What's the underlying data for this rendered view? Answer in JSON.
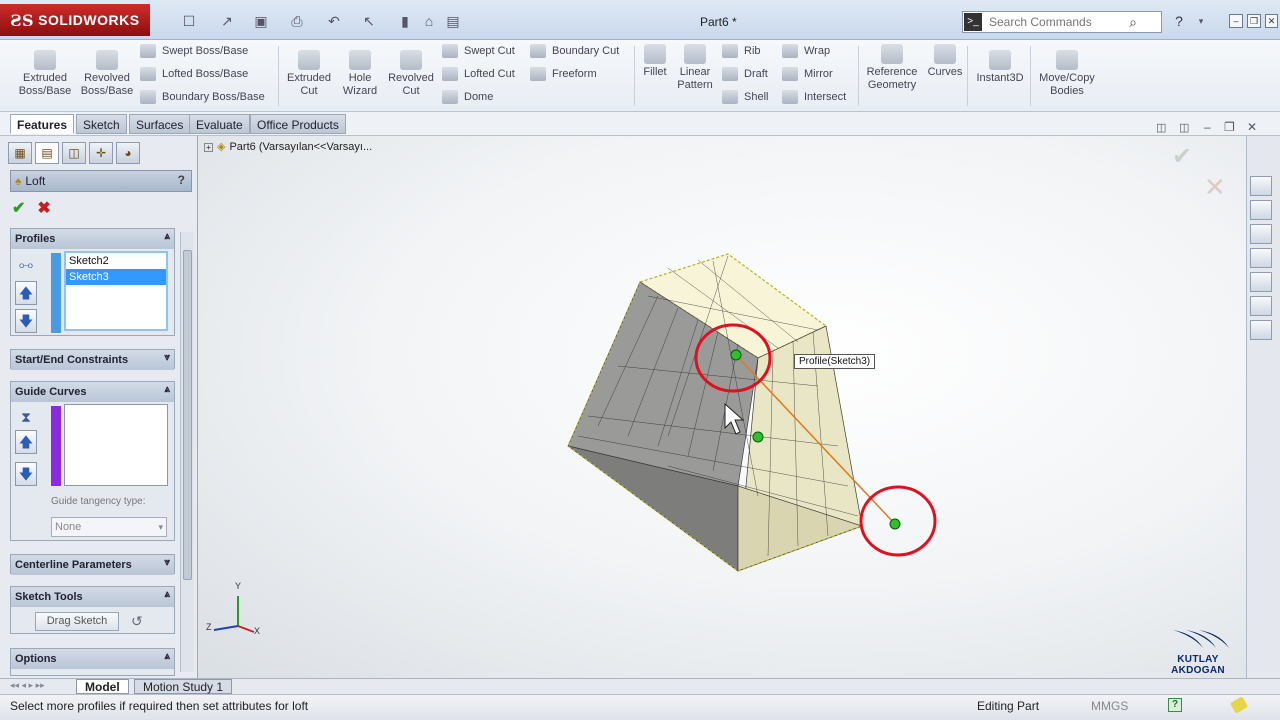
{
  "app": {
    "logo_text": "SOLIDWORKS",
    "document_title": "Part6 *",
    "search_placeholder": "Search Commands"
  },
  "ribbon": {
    "extruded_boss": "Extruded\nBoss/Base",
    "revolved_boss": "Revolved\nBoss/Base",
    "swept_boss": "Swept Boss/Base",
    "lofted_boss": "Lofted Boss/Base",
    "boundary_boss": "Boundary Boss/Base",
    "extruded_cut": "Extruded\nCut",
    "hole_wizard": "Hole\nWizard",
    "revolved_cut": "Revolved\nCut",
    "swept_cut": "Swept Cut",
    "lofted_cut": "Lofted Cut",
    "boundary_cut": "Boundary Cut",
    "dome": "Dome",
    "freeform": "Freeform",
    "fillet": "Fillet",
    "linear_pattern": "Linear\nPattern",
    "rib": "Rib",
    "draft": "Draft",
    "shell": "Shell",
    "wrap": "Wrap",
    "mirror": "Mirror",
    "intersect": "Intersect",
    "reference_geometry": "Reference\nGeometry",
    "curves": "Curves",
    "instant3d": "Instant3D",
    "move_copy_bodies": "Move/Copy\nBodies"
  },
  "command_tabs": [
    "Features",
    "Sketch",
    "Surfaces",
    "Evaluate",
    "Office Products"
  ],
  "property_manager": {
    "title": "Loft",
    "help": "?",
    "profiles": {
      "label": "Profiles",
      "items": [
        "Sketch2",
        "Sketch3"
      ],
      "selected": "Sketch3"
    },
    "start_end_constraints": "Start/End Constraints",
    "guide_curves": {
      "label": "Guide Curves",
      "tangency_label": "Guide tangency type:",
      "tangency_value": "None"
    },
    "centerline_parameters": "Centerline Parameters",
    "sketch_tools": {
      "label": "Sketch Tools",
      "drag_sketch": "Drag Sketch"
    },
    "options": "Options"
  },
  "viewport": {
    "tree_node": "Part6  (Varsayılan<<Varsayı...",
    "tooltip": "Profile(Sketch3)",
    "triad": {
      "x": "X",
      "y": "Y",
      "z": "Z"
    },
    "brand_name": "KUTLAY AKDOGAN"
  },
  "bottom_tabs": [
    "Model",
    "Motion Study 1"
  ],
  "status": {
    "message": "Select more profiles if required then set attributes for loft",
    "mode": "Editing Part",
    "units": "MMGS"
  },
  "colors": {
    "profile_color": "#4a9be0",
    "guide_color": "#8a2be2",
    "selection": "#3399ff",
    "annotation_circle": "#e01020",
    "loft_fill": "#f5f3d6",
    "connector_line": "#e07b1a"
  }
}
